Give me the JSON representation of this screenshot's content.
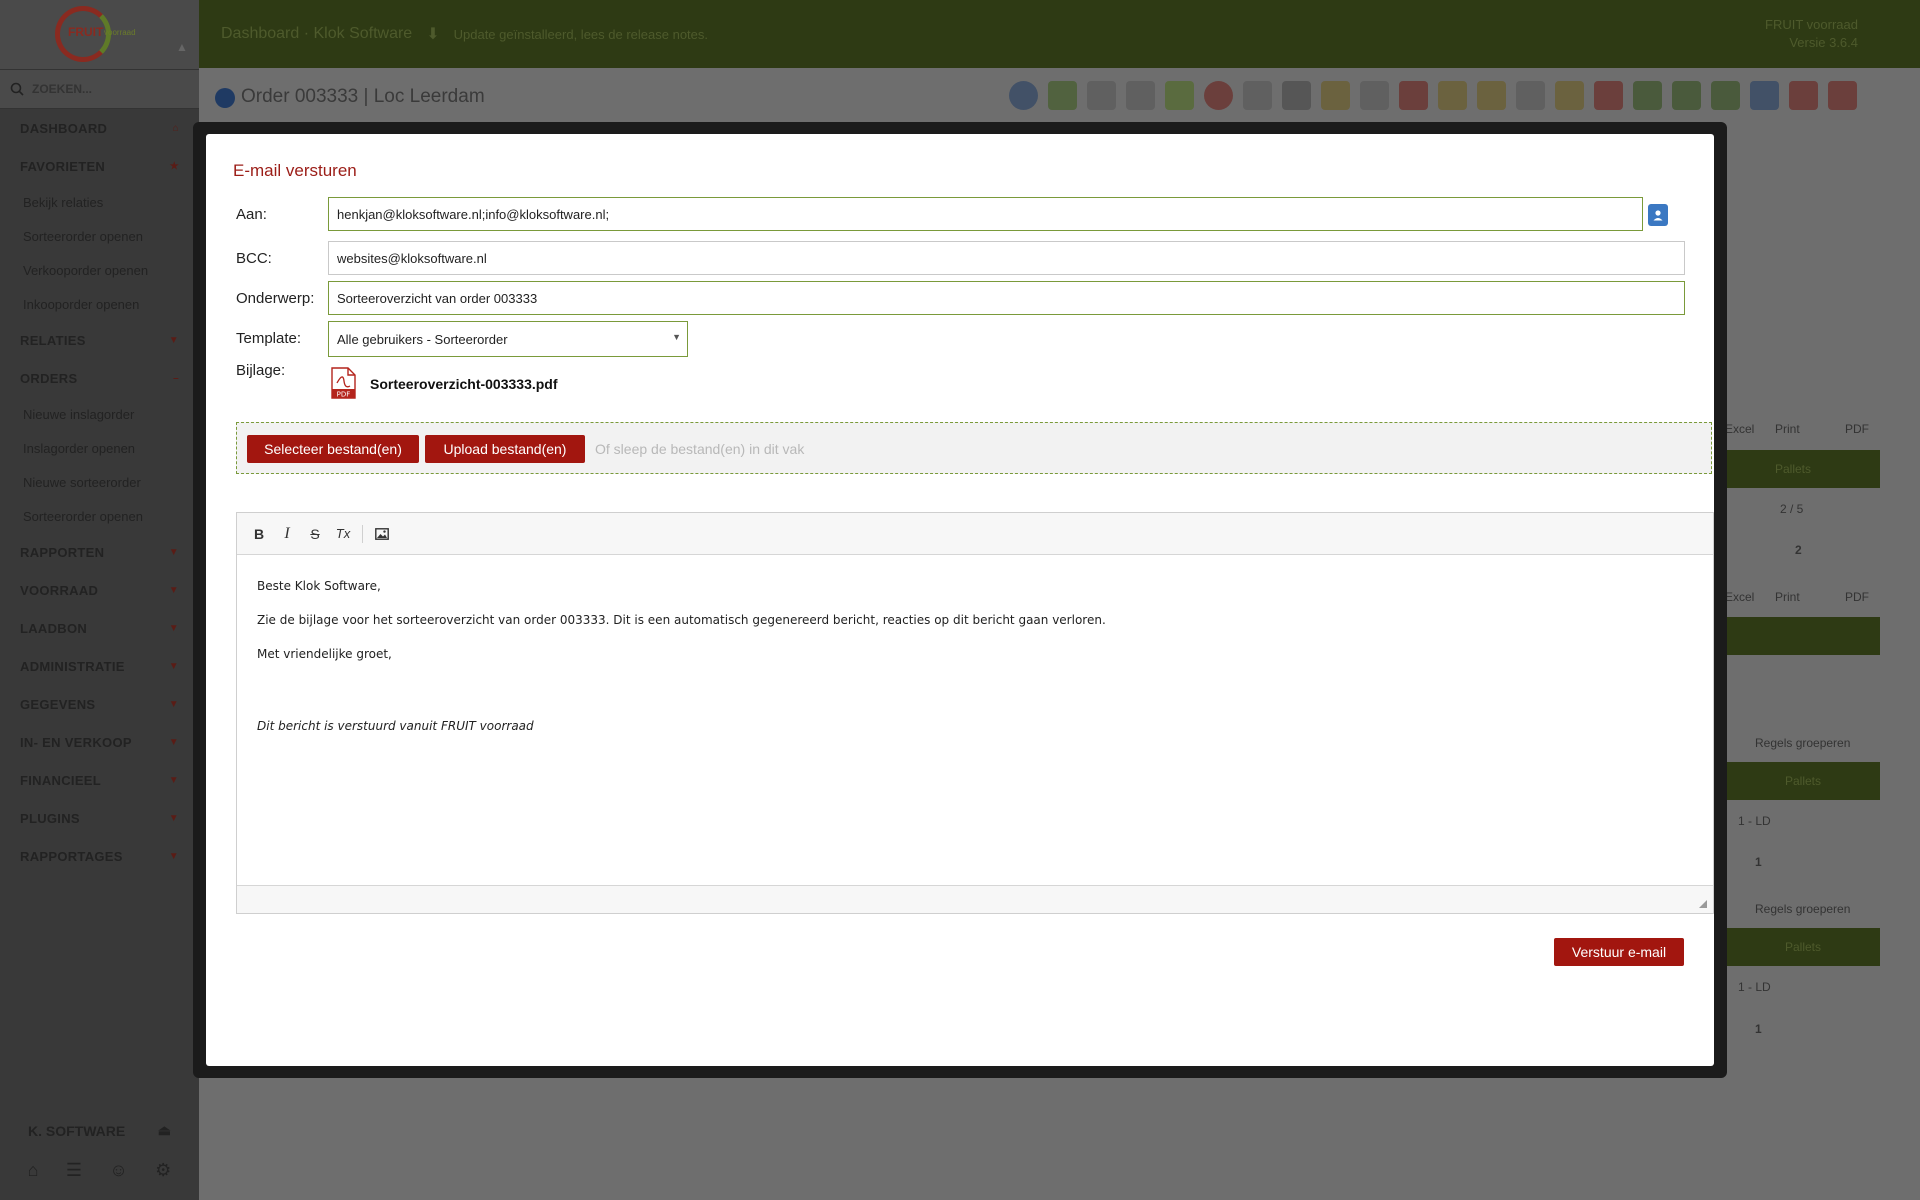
{
  "app": {
    "logo_text": "FRUIT",
    "logo_sub": "voorraad",
    "search_placeholder": "ZOEKEN...",
    "topbar_notice": "Update geïnstalleerd, lees de release notes.",
    "topbar_breadcrumb": "Dashboard · Klok Software",
    "product_name": "FRUIT voorraad",
    "version": "Versie 3.6.4",
    "user_name": "K. SOFTWARE"
  },
  "sidebar": {
    "sections": [
      {
        "label": "DASHBOARD",
        "icon": "home-icon"
      },
      {
        "label": "FAVORIETEN",
        "icon": "star-icon",
        "items": [
          "Bekijk relaties",
          "Sorteerorder openen",
          "Verkooporder openen",
          "Inkooporder openen"
        ]
      },
      {
        "label": "RELATIES",
        "icon": "caret-down-icon"
      },
      {
        "label": "ORDERS",
        "icon": "minus-icon",
        "items": [
          "Nieuwe inslagorder",
          "Inslagorder openen",
          "Nieuwe sorteerorder",
          "Sorteerorder openen"
        ]
      },
      {
        "label": "RAPPORTEN",
        "icon": "caret-down-icon"
      },
      {
        "label": "VOORRAAD",
        "icon": "caret-down-icon"
      },
      {
        "label": "LAADBON",
        "icon": "caret-down-icon"
      },
      {
        "label": "ADMINISTRATIE",
        "icon": "caret-down-icon"
      },
      {
        "label": "GEGEVENS",
        "icon": "caret-down-icon"
      },
      {
        "label": "IN- EN VERKOOP",
        "icon": "caret-down-icon"
      },
      {
        "label": "FINANCIEEL",
        "icon": "caret-down-icon"
      },
      {
        "label": "PLUGINS",
        "icon": "caret-down-icon"
      },
      {
        "label": "RAPPORTAGES",
        "icon": "caret-down-icon"
      }
    ]
  },
  "page": {
    "title": "Order 003333 | Loc Leerdam",
    "bg_labels": {
      "excel": "Excel",
      "print": "Print",
      "pdf": "PDF",
      "pallets": "Pallets",
      "ratio": "2 / 5",
      "two": "2",
      "group_rows": "Regels groeperen",
      "loc": "1 - LD",
      "one": "1"
    }
  },
  "modal": {
    "title": "E-mail versturen",
    "labels": {
      "to": "Aan:",
      "bcc": "BCC:",
      "subject": "Onderwerp:",
      "template": "Template:",
      "attachment": "Bijlage:"
    },
    "to_value": "henkjan@kloksoftware.nl;info@kloksoftware.nl;",
    "bcc_value": "websites@kloksoftware.nl",
    "subject_value": "Sorteeroverzicht van order 003333",
    "template_value": "Alle gebruikers - Sorteerorder",
    "attachment_name": "Sorteeroverzicht-003333.pdf",
    "attachment_badge": "PDF",
    "select_files_label": "Selecteer bestand(en)",
    "upload_files_label": "Upload bestand(en)",
    "drop_hint": "Of sleep de bestand(en) in dit vak",
    "editor": {
      "toolbar": [
        "B",
        "I",
        "S",
        "Tx",
        "image"
      ],
      "greeting": "Beste Klok Software,",
      "body": "Zie de bijlage voor het sorteeroverzicht van order 003333. Dit is een automatisch gegenereerd bericht, reacties op dit bericht gaan verloren.",
      "closing": "Met vriendelijke groet,",
      "signature": "Dit bericht is verstuurd vanuit FRUIT voorraad"
    },
    "send_label": "Verstuur e-mail"
  },
  "colors": {
    "accent_red": "#a2160f",
    "accent_green": "#7a9a3a",
    "overlay_topbar": "#2e3a14"
  }
}
